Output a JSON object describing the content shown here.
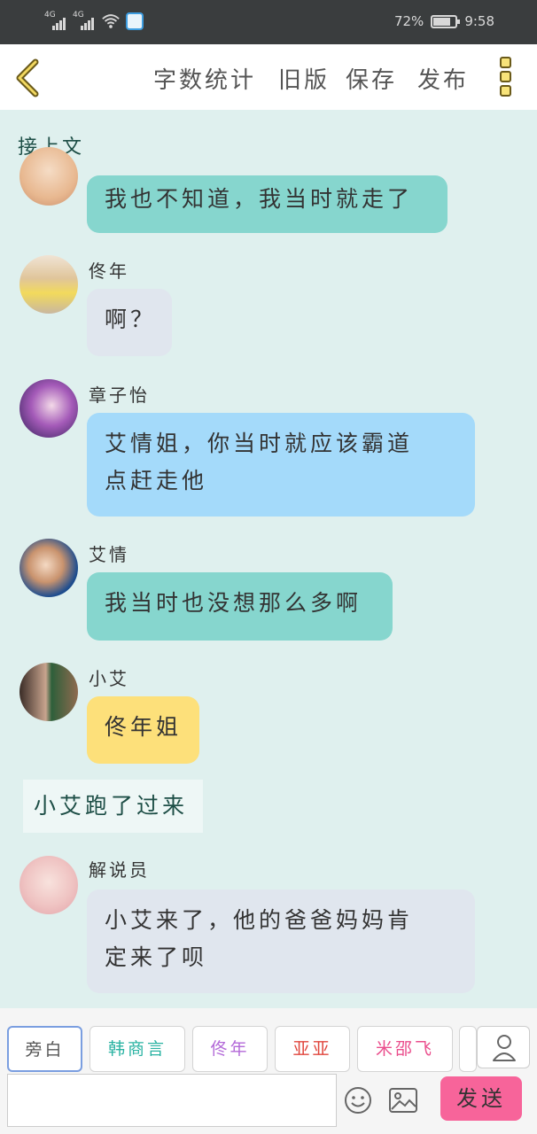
{
  "status_bar": {
    "network_1": "4G",
    "network_2": "4G",
    "battery_percent": "72%",
    "battery_level": 0.72,
    "time": "9:58"
  },
  "toolbar": {
    "back_icon": "chevron-left-icon",
    "word_count": "字数统计",
    "old_version": "旧版",
    "save": "保存",
    "publish": "发布",
    "more_icon": "more-vertical-icon"
  },
  "chat": {
    "continue_label": "接上文",
    "messages": [
      {
        "name": "",
        "text": "我也不知道，我当时就走了",
        "color": "#86d6ce"
      },
      {
        "name": "佟年",
        "text": "啊？",
        "color": "#e0e6ee"
      },
      {
        "name": "章子怡",
        "text_line1": "艾情姐，你当时就应该霸道",
        "text_line2": "点赶走他",
        "color": "#a4dafa"
      },
      {
        "name": "艾情",
        "text": "我当时也没想那么多啊",
        "color": "#86d6ce"
      },
      {
        "name": "小艾",
        "text": "佟年姐",
        "color": "#fde07a"
      },
      {
        "narration": "小艾跑了过来"
      },
      {
        "name": "解说员",
        "text_line1": "小艾来了，他的爸爸妈妈肯",
        "text_line2": "定来了呗",
        "color": "#e0e6ee"
      }
    ]
  },
  "composer": {
    "characters": [
      {
        "label": "旁白",
        "color": "#555555"
      },
      {
        "label": "韩商言",
        "color": "#2bb3a3"
      },
      {
        "label": "佟年",
        "color": "#b36ad8"
      },
      {
        "label": "亚亚",
        "color": "#e0453c"
      },
      {
        "label": "米邵飞",
        "color": "#ea4d8c"
      }
    ],
    "user_icon": "user-icon",
    "input_value": "",
    "emoji_icon": "emoji-icon",
    "image_icon": "image-icon",
    "send": "发送"
  }
}
